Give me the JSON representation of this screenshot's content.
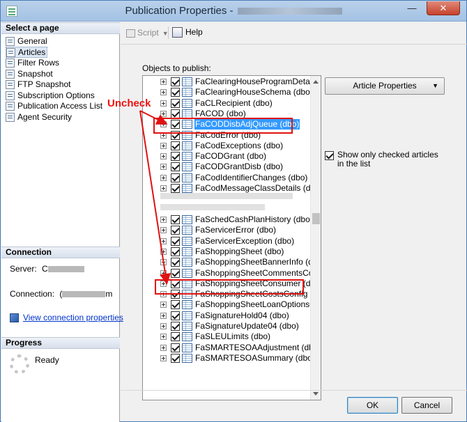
{
  "window": {
    "title": "Publication Properties -",
    "minimize_glyph": "—",
    "close_glyph": "✕"
  },
  "left_panel": {
    "select_page_header": "Select a page",
    "pages": [
      {
        "label": "General",
        "icon": "page-icon"
      },
      {
        "label": "Articles",
        "icon": "page-icon",
        "selected": true
      },
      {
        "label": "Filter Rows",
        "icon": "page-icon"
      },
      {
        "label": "Snapshot",
        "icon": "page-icon"
      },
      {
        "label": "FTP Snapshot",
        "icon": "page-icon"
      },
      {
        "label": "Subscription Options",
        "icon": "page-icon"
      },
      {
        "label": "Publication Access List",
        "icon": "users-icon"
      },
      {
        "label": "Agent Security",
        "icon": "agent-icon"
      }
    ],
    "connection_header": "Connection",
    "server_label": "Server:",
    "server_value_prefix": "C",
    "connection_label": "Connection:",
    "connection_value_prefix": "(",
    "connection_value_suffix": "m",
    "view_connection_link": "View connection properties",
    "progress_header": "Progress",
    "progress_status": "Ready"
  },
  "toolbar": {
    "script_label": "Script",
    "script_dropdown": "▼",
    "help_label": "Help"
  },
  "articles": {
    "objects_label": "Objects to publish:",
    "article_properties_button": "Article Properties",
    "article_properties_dropdown": "▼",
    "show_only_checked_label": "Show only checked articles in the list",
    "show_only_checked_value": true,
    "items_top": [
      "FaClearingHouseProgramDetail (dbo",
      "FaClearingHouseSchema (dbo)",
      "FaCLRecipient (dbo)",
      "FACOD (dbo)",
      "FaCODDisbAdjQueue (dbo)",
      "FaCodError (dbo)",
      "FaCodExceptions (dbo)",
      "FaCODGrant (dbo)",
      "FaCODGrantDisb (dbo)",
      "FaCodIdentifierChanges (dbo)",
      "FaCodMessageClassDetails (dbo)"
    ],
    "items_bottom": [
      "FaSchedCashPlanHistory (dbo)",
      "FaServicerError (dbo)",
      "FaServicerException (dbo)",
      "FaShoppingSheet (dbo)",
      "FaShoppingSheetBannerInfo (dbo)",
      "FaShoppingSheetCommentsConfig (",
      "FaShoppingSheetConsumer (dbo)",
      "FaShoppingSheetCostsConfig (dbo)",
      "FaShoppingSheetLoanOptionsConfig",
      "FaSignatureHold04 (dbo)",
      "FaSignatureUpdate04 (dbo)",
      "FaSLEULimits (dbo)",
      "FaSMARTESOAAdjustment (dbo)",
      "FaSMARTESOASummary (dbo)"
    ]
  },
  "buttons": {
    "ok": "OK",
    "cancel": "Cancel"
  },
  "annotation": {
    "label": "Uncheck",
    "color": "#e11111"
  }
}
